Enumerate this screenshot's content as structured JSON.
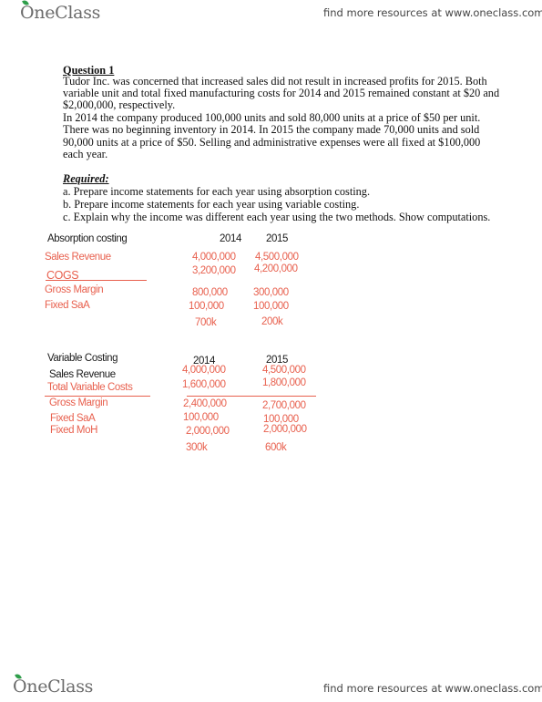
{
  "header": {
    "logo": "OneClass",
    "tagline": "find more resources at www.oneclass.com"
  },
  "footer": {
    "logo": "OneClass",
    "tagline": "find more resources at www.oneclass.com"
  },
  "question": {
    "title": "Question 1",
    "lines": [
      "Tudor Inc. was concerned that increased sales did not result in increased profits for 2015. Both",
      "variable unit and total fixed manufacturing costs for 2014 and 2015 remained constant at $20 and",
      "$2,000,000, respectively.",
      "In 2014 the company produced 100,000 units and sold 80,000 units at a price of $50 per unit.",
      "There was no beginning inventory in 2014. In 2015 the company made 70,000 units and sold",
      "90,000 units at a price of $50. Selling and administrative expenses were all fixed at $100,000",
      "each year."
    ],
    "required_title": "Required:",
    "required_items": [
      "a.  Prepare income statements for each year using absorption costing.",
      "b.  Prepare income statements for each year using variable costing.",
      "c.  Explain why the income was different each year using the two methods. Show computations."
    ]
  },
  "absorption": {
    "title": "Absorption costing",
    "years": [
      "2014",
      "2015"
    ],
    "rows": [
      {
        "label": "Sales Revenue",
        "v2014": "4,000,000",
        "v2015": "4,500,000"
      },
      {
        "label": "COGS",
        "v2014": "3,200,000",
        "v2015": "4,200,000"
      },
      {
        "label": "Gross Margin",
        "v2014": "800,000",
        "v2015": "300,000"
      },
      {
        "label": "Fixed SaA",
        "v2014": "100,000",
        "v2015": "100,000"
      }
    ],
    "net": {
      "v2014": "700k",
      "v2015": "200k"
    }
  },
  "variable": {
    "title": "Variable Costing",
    "years": [
      "2014",
      "2015"
    ],
    "rows": [
      {
        "label": "Sales Revenue",
        "v2014": "4,000,000",
        "v2015": "4,500,000"
      },
      {
        "label": "Total Variable Costs",
        "v2014": "1,600,000",
        "v2015": "1,800,000"
      },
      {
        "label": "Gross Margin",
        "v2014": "2,400,000",
        "v2015": "2,700,000"
      },
      {
        "label": "Fixed SaA",
        "v2014": "100,000",
        "v2015": "100,000"
      },
      {
        "label": "Fixed MoH",
        "v2014": "2,000,000",
        "v2015": "2,000,000"
      }
    ],
    "net": {
      "v2014": "300k",
      "v2015": "600k"
    }
  }
}
